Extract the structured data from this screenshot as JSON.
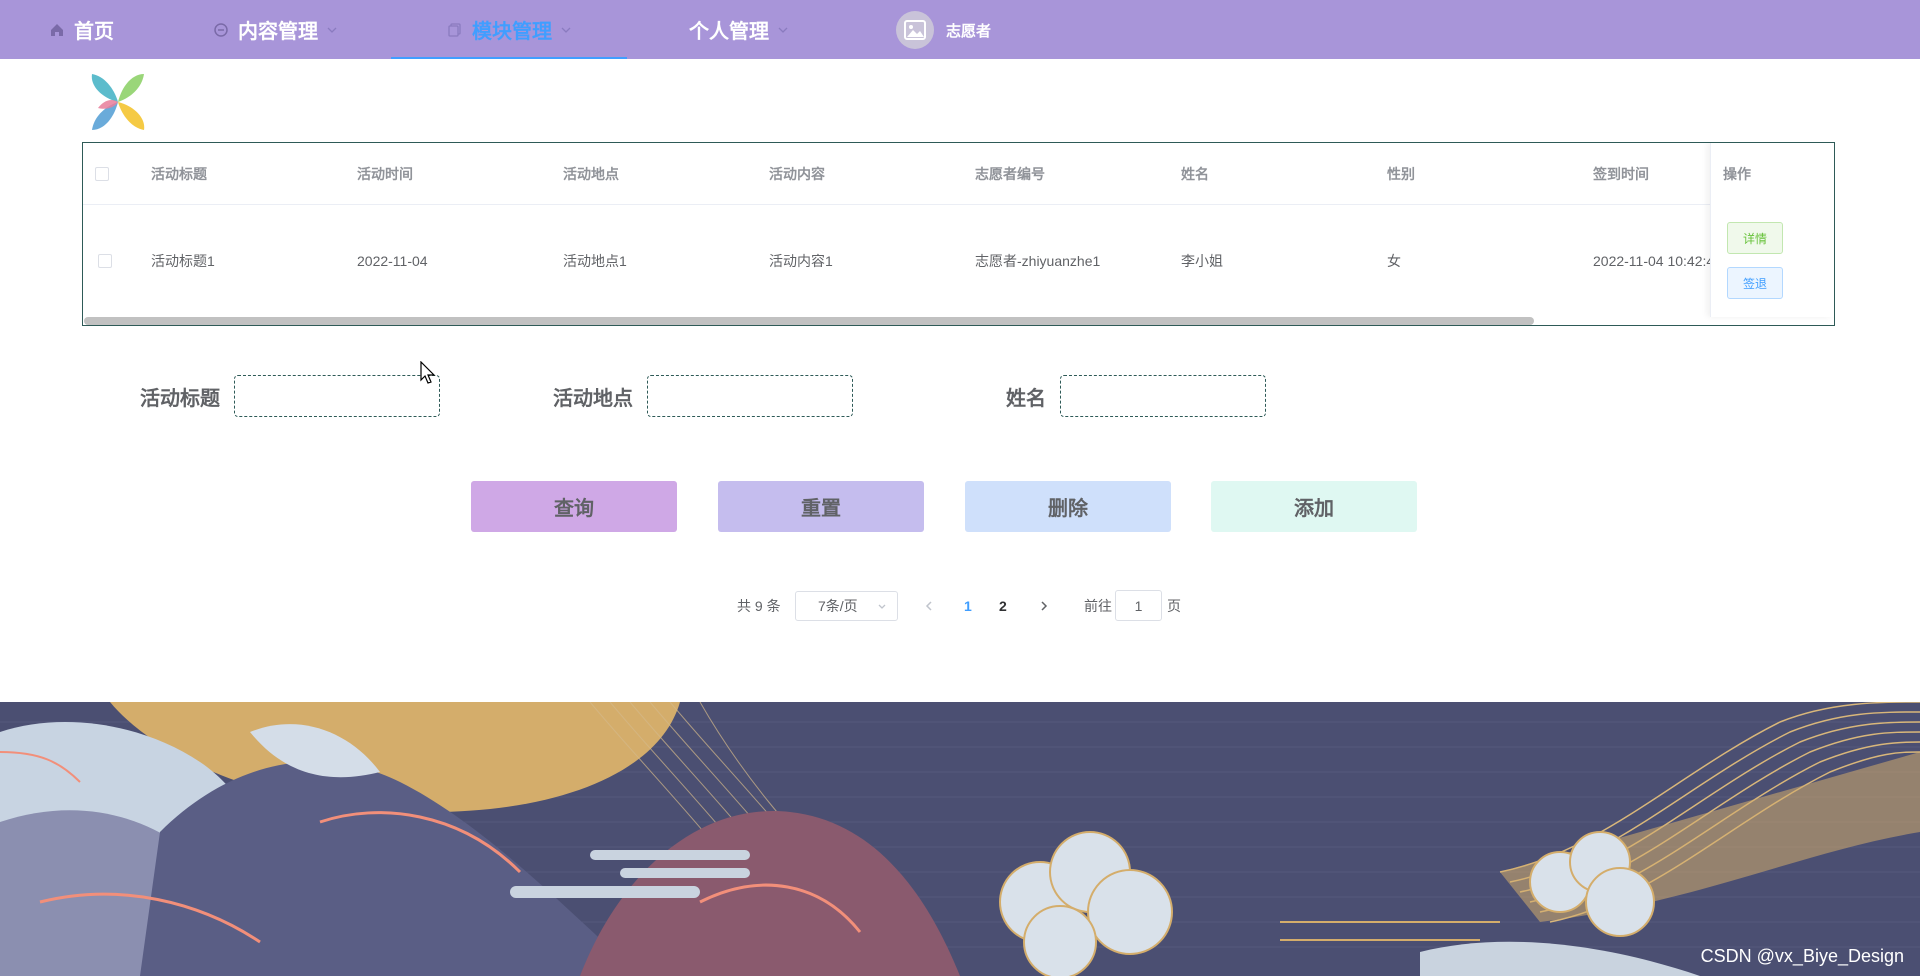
{
  "nav": {
    "items": [
      {
        "label": "首页",
        "icon": "home-icon"
      },
      {
        "label": "内容管理",
        "icon": "circle-icon"
      },
      {
        "label": "模块管理",
        "icon": "copy-icon",
        "active": true
      },
      {
        "label": "个人管理"
      }
    ],
    "user_name": "志愿者"
  },
  "table": {
    "columns": [
      "活动标题",
      "活动时间",
      "活动地点",
      "活动内容",
      "志愿者编号",
      "姓名",
      "性别",
      "签到时间"
    ],
    "ops_header": "操作",
    "rows": [
      {
        "title": "活动标题1",
        "time": "2022-11-04",
        "place": "活动地点1",
        "content": "活动内容1",
        "volunteer_id": "志愿者-zhiyuanzhe1",
        "name": "李小姐",
        "gender": "女",
        "signin_time": "2022-11-04 10:42:4"
      }
    ],
    "detail_label": "详情",
    "signout_label": "签退"
  },
  "search": {
    "title_label": "活动标题",
    "place_label": "活动地点",
    "name_label": "姓名",
    "title_value": "",
    "place_value": "",
    "name_value": ""
  },
  "actions": {
    "query": "查询",
    "reset": "重置",
    "delete": "删除",
    "add": "添加"
  },
  "pagination": {
    "total_text": "共 9 条",
    "page_size": "7条/页",
    "pages": [
      "1",
      "2"
    ],
    "current_page": "1",
    "goto_prefix": "前往",
    "goto_value": "1",
    "goto_suffix": "页"
  },
  "watermark": "CSDN @vx_Biye_Design",
  "colors": {
    "nav_bg": "#a895d9",
    "active": "#409eff",
    "query_bg": "#cfa8e6",
    "reset_bg": "#c5bdee",
    "delete_bg": "#cfe0fb",
    "add_bg": "#dff8f2"
  }
}
